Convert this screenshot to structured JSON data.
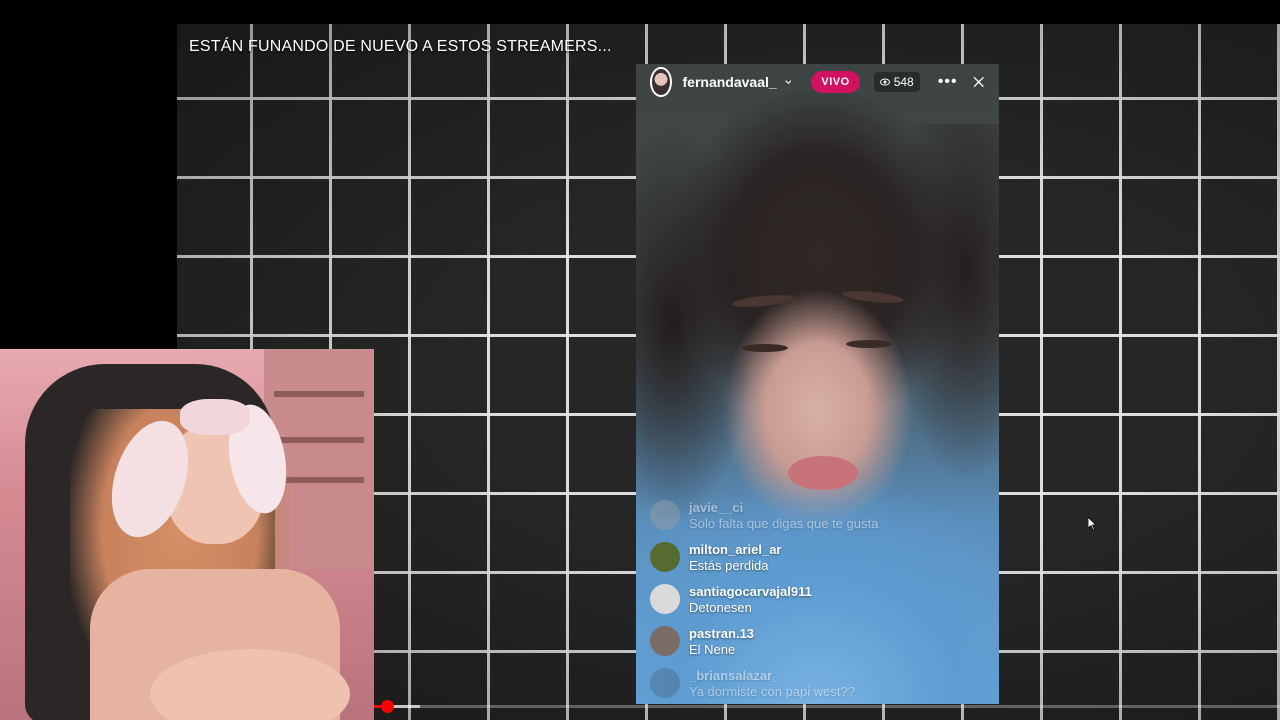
{
  "video": {
    "title": "ESTÁN FUNANDO DE NUEVO A ESTOS STREAMERS...",
    "progress_played": 0.013
  },
  "live": {
    "username": "fernandavaal_",
    "live_badge": "VIVO",
    "viewer_count": "548",
    "icons": {
      "dropdown": "chevron-down-icon",
      "viewers": "eye-icon",
      "more": "more-icon",
      "close": "close-icon"
    },
    "comments": [
      {
        "user": "javie__ci",
        "message": "Solo falta que digas que te gusta",
        "faded": true,
        "avatar_color": "#9aa0a6"
      },
      {
        "user": "milton_ariel_ar",
        "message": "Estás perdida",
        "faded": false,
        "avatar_color": "#556b2f"
      },
      {
        "user": "santiagocarvajal911",
        "message": "Detonesen",
        "faded": false,
        "avatar_color": "#dadada"
      },
      {
        "user": "pastran.13",
        "message": "El Nene",
        "faded": false,
        "avatar_color": "#7a6d66"
      },
      {
        "user": "_briansalazar_",
        "message": "Ya dormiste con papi west??",
        "faded": true,
        "avatar_color": "#4c6c8c"
      }
    ]
  },
  "colors": {
    "live_badge": "#d1125f",
    "progress": "#ff0000",
    "grid_line": "#ebebeb",
    "grid_bg": "#262626"
  }
}
